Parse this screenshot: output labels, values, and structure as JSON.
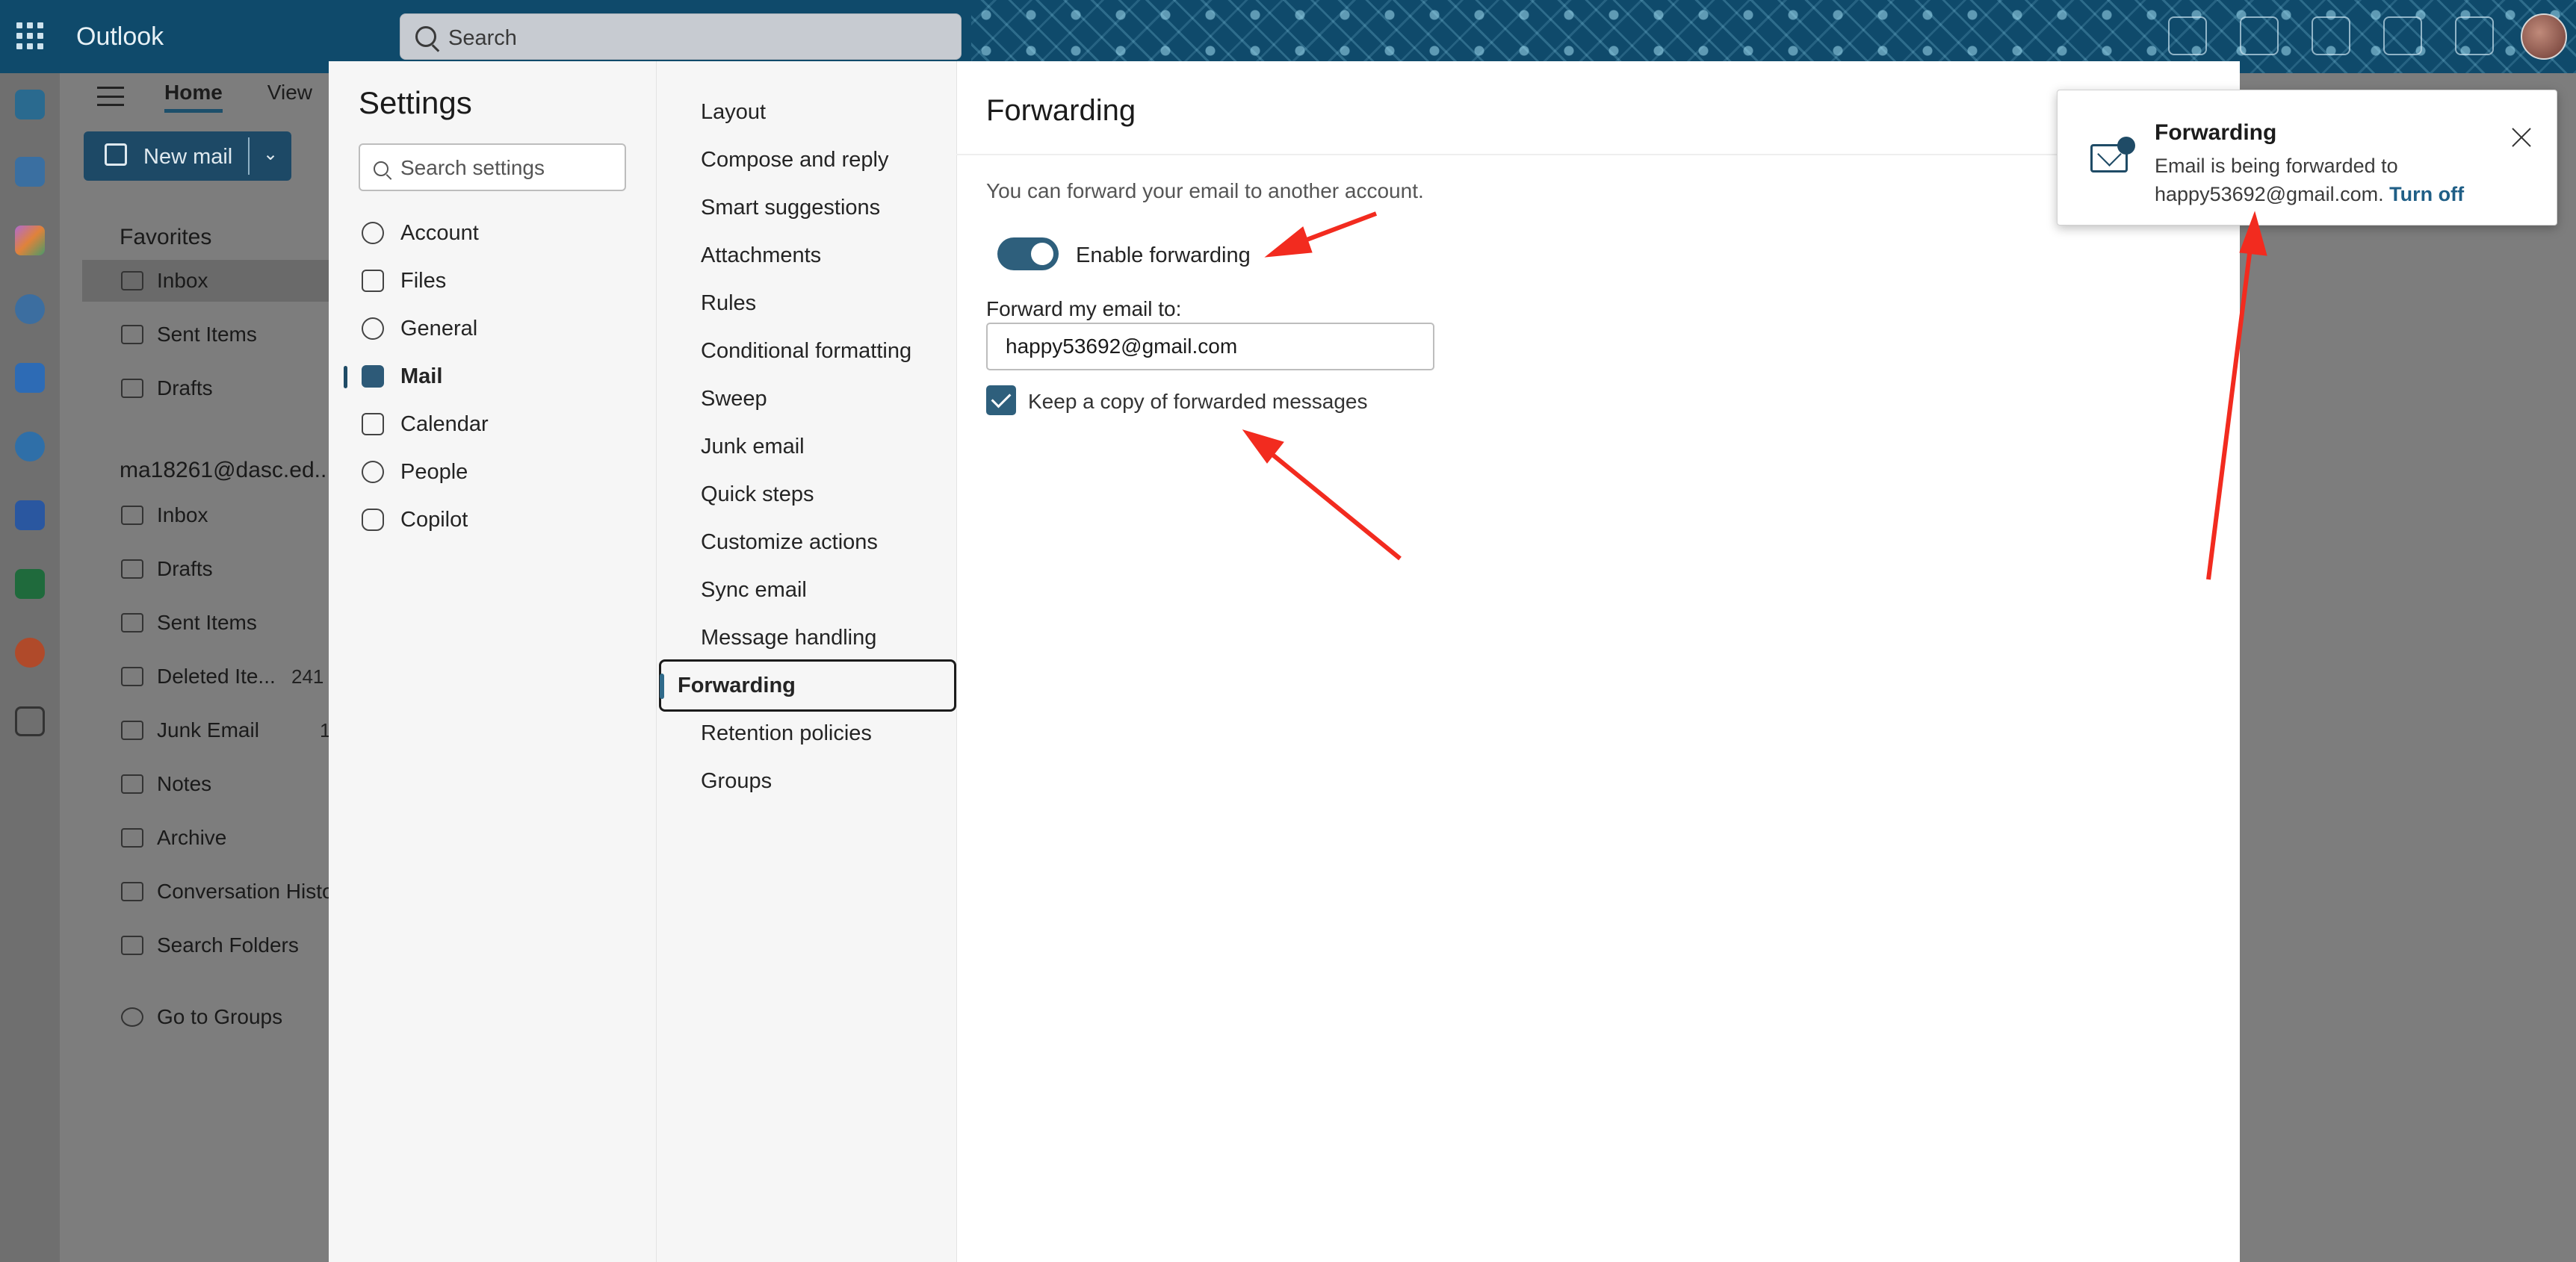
{
  "app": {
    "name": "Outlook",
    "search_placeholder": "Search"
  },
  "ribbon": {
    "tabs": [
      "Home",
      "View"
    ],
    "new_mail_label": "New mail"
  },
  "folders": {
    "favorites_label": "Favorites",
    "favorites": [
      {
        "label": "Inbox"
      },
      {
        "label": "Sent Items"
      },
      {
        "label": "Drafts"
      }
    ],
    "account_label": "ma18261@dasc.ed...",
    "account_folders": [
      {
        "label": "Inbox"
      },
      {
        "label": "Drafts"
      },
      {
        "label": "Sent Items"
      },
      {
        "label": "Deleted Ite...",
        "count": "241"
      },
      {
        "label": "Junk Email",
        "count": "1"
      },
      {
        "label": "Notes"
      },
      {
        "label": "Archive"
      },
      {
        "label": "Conversation Histo"
      },
      {
        "label": "Search Folders"
      }
    ],
    "go_to_groups": "Go to Groups"
  },
  "settings": {
    "title": "Settings",
    "search_placeholder": "Search settings",
    "categories": [
      {
        "label": "Account",
        "icon": "person-icon"
      },
      {
        "label": "Files",
        "icon": "file-icon"
      },
      {
        "label": "General",
        "icon": "gear-icon"
      },
      {
        "label": "Mail",
        "icon": "mail-icon",
        "active": true
      },
      {
        "label": "Calendar",
        "icon": "calendar-icon"
      },
      {
        "label": "People",
        "icon": "people-icon"
      },
      {
        "label": "Copilot",
        "icon": "copilot-icon"
      }
    ],
    "mail_sections": [
      "Layout",
      "Compose and reply",
      "Smart suggestions",
      "Attachments",
      "Rules",
      "Conditional formatting",
      "Sweep",
      "Junk email",
      "Quick steps",
      "Customize actions",
      "Sync email",
      "Message handling",
      "Forwarding",
      "Retention policies",
      "Groups"
    ],
    "active_section": "Forwarding"
  },
  "forwarding": {
    "title": "Forwarding",
    "description": "You can forward your email to another account.",
    "enable_label": "Enable forwarding",
    "enabled": true,
    "forward_to_label": "Forward my email to:",
    "forward_to_value": "happy53692@gmail.com",
    "keep_copy_label": "Keep a copy of forwarded messages",
    "keep_copy": true
  },
  "toast": {
    "title": "Forwarding",
    "body": "Email is being forwarded to happy53692@gmail.com.",
    "action": "Turn off"
  },
  "colors": {
    "accent": "#2e5f7c",
    "annotation_arrow": "#f22b1f"
  }
}
